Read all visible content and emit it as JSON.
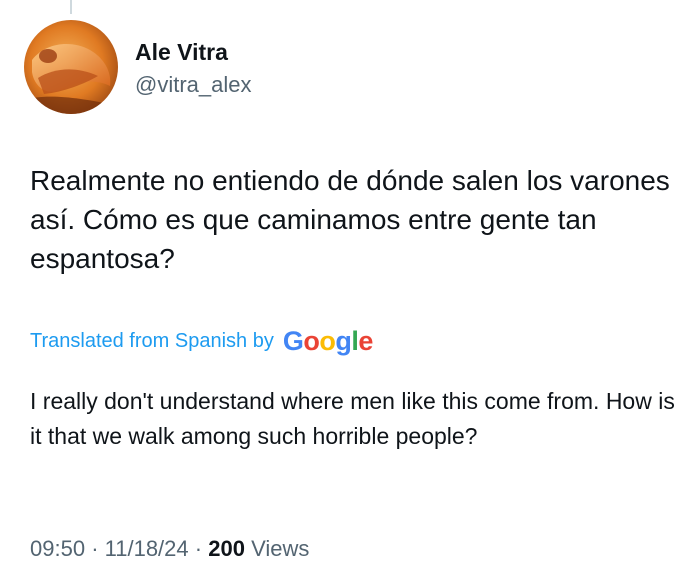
{
  "author": {
    "display_name": "Ale Vitra",
    "handle": "@vitra_alex"
  },
  "tweet": {
    "text": "Realmente no entiendo de dónde salen los varones así. Cómo es que caminamos entre gente tan espantosa?"
  },
  "translation": {
    "label": "Translated from Spanish by",
    "provider_letters": [
      "G",
      "o",
      "o",
      "g",
      "l",
      "e"
    ],
    "text": "I really don't understand where men like this come from. How is it that we walk among such horrible people?"
  },
  "meta": {
    "time": "09:50",
    "separator": "·",
    "date": "11/18/24",
    "views_count": "200",
    "views_label": "Views"
  },
  "colors": {
    "link": "#1d9bf0",
    "secondary_text": "#536471",
    "primary_text": "#0f1419",
    "google_blue": "#4285f4",
    "google_red": "#ea4335",
    "google_yellow": "#fbbc05",
    "google_green": "#34a853"
  }
}
